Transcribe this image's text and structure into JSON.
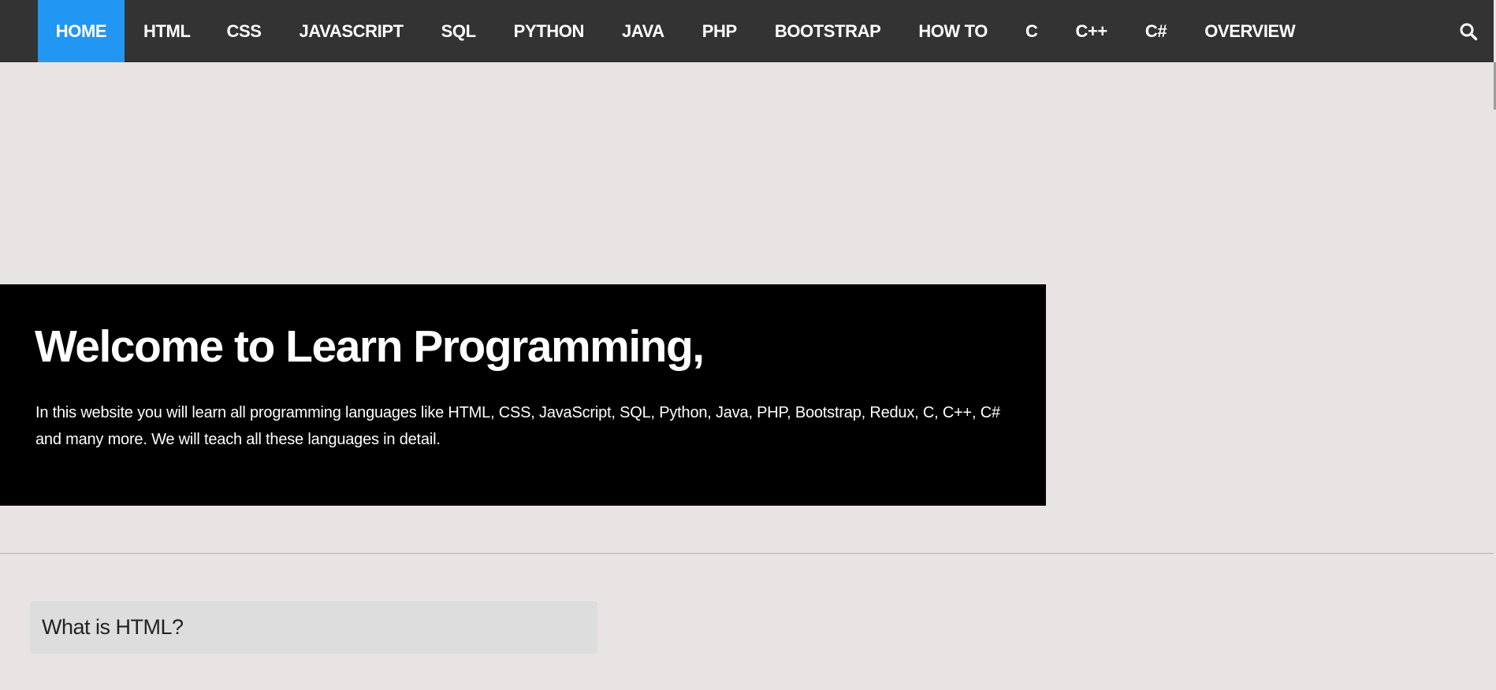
{
  "nav": {
    "items": [
      {
        "label": "HOME",
        "active": true
      },
      {
        "label": "HTML",
        "active": false
      },
      {
        "label": "CSS",
        "active": false
      },
      {
        "label": "JAVASCRIPT",
        "active": false
      },
      {
        "label": "SQL",
        "active": false
      },
      {
        "label": "PYTHON",
        "active": false
      },
      {
        "label": "JAVA",
        "active": false
      },
      {
        "label": "PHP",
        "active": false
      },
      {
        "label": "BOOTSTRAP",
        "active": false
      },
      {
        "label": "HOW TO",
        "active": false
      },
      {
        "label": "C",
        "active": false
      },
      {
        "label": "C++",
        "active": false
      },
      {
        "label": "C#",
        "active": false
      },
      {
        "label": "OVERVIEW",
        "active": false
      }
    ],
    "search_icon": "search-icon"
  },
  "hero": {
    "title": "Welcome to Learn Programming,",
    "text": "In this website you will learn all programming languages like HTML, CSS, JavaScript, SQL, Python, Java, PHP, Bootstrap, Redux, C, C++, C# and many more. We will teach all these languages in detail."
  },
  "sections": [
    {
      "heading": "What is HTML?"
    }
  ],
  "colors": {
    "nav_background": "#333333",
    "nav_active": "#2196f3",
    "page_background": "#e8e4e3",
    "hero_background": "#000000",
    "accordion_background": "#dddddd"
  }
}
